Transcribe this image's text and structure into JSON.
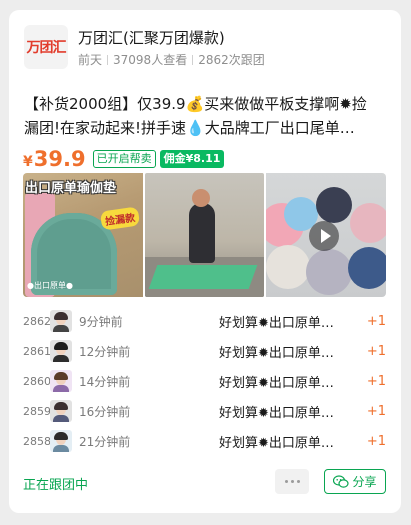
{
  "header": {
    "logo_text": "万团汇",
    "shop_name": "万团汇(汇聚万团爆款)",
    "posted": "前天",
    "views": "37098人查看",
    "follows": "2862次跟团"
  },
  "post": {
    "title_line1": "【补货2000组】仅39.9💰买来做做平板支撑啊✹捡",
    "title_line2": "漏团!在家动起来!拼手速💧大品牌工厂出口尾单…",
    "price_currency": "¥",
    "price_value": "39.9",
    "tag_buy": "已开启帮卖",
    "tag_commission": "佣金¥8.11"
  },
  "images": {
    "img1_title": "出口原单瑜伽垫",
    "img1_badge": "捡漏款",
    "img1_foot": "●出口原单●"
  },
  "orders": [
    {
      "num": "2862",
      "time": "9分钟前",
      "desc": "好划算✹出口原单…",
      "qty": "+1"
    },
    {
      "num": "2861",
      "time": "12分钟前",
      "desc": "好划算✹出口原单…",
      "qty": "+1"
    },
    {
      "num": "2860",
      "time": "14分钟前",
      "desc": "好划算✹出口原单…",
      "qty": "+1"
    },
    {
      "num": "2859",
      "time": "16分钟前",
      "desc": "好划算✹出口原单…",
      "qty": "+1"
    },
    {
      "num": "2858",
      "time": "21分钟前",
      "desc": "好划算✹出口原单…",
      "qty": "+1"
    }
  ],
  "footer": {
    "following": "正在跟团中",
    "share": "分享"
  },
  "colors": {
    "accent_green": "#09a551",
    "price_orange": "#ef6f2c"
  }
}
